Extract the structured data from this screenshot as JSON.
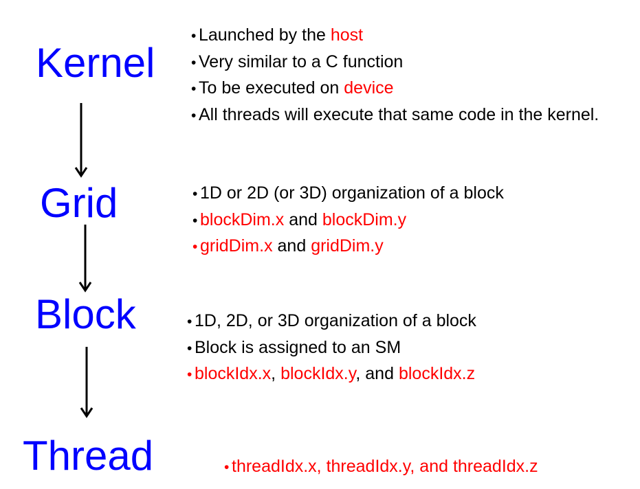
{
  "levels": {
    "kernel": {
      "title": "Kernel",
      "bullets": [
        [
          {
            "text": "Launched by the ",
            "color": "black"
          },
          {
            "text": "host",
            "color": "red"
          }
        ],
        [
          {
            "text": "Very similar to a C function",
            "color": "black"
          }
        ],
        [
          {
            "text": "To be executed on ",
            "color": "black"
          },
          {
            "text": "device",
            "color": "red"
          }
        ],
        [
          {
            "text": "All threads will execute that same code in the kernel.",
            "color": "black"
          }
        ]
      ]
    },
    "grid": {
      "title": "Grid",
      "bullets": [
        [
          {
            "text": "1D or 2D (or 3D) organization of a block",
            "color": "black"
          }
        ],
        [
          {
            "text": "blockDim.x",
            "color": "red"
          },
          {
            "text": " and ",
            "color": "black"
          },
          {
            "text": "blockDim.y",
            "color": "red"
          }
        ],
        [
          {
            "text": "gridDim.x",
            "color": "red"
          },
          {
            "text": " and ",
            "color": "black"
          },
          {
            "text": "gridDim.y",
            "color": "red"
          }
        ]
      ],
      "bullet_colors": [
        "black",
        "black",
        "red"
      ]
    },
    "block": {
      "title": "Block",
      "bullets": [
        [
          {
            "text": "1D, 2D, or 3D organization of a block",
            "color": "black"
          }
        ],
        [
          {
            "text": "Block is assigned to an SM",
            "color": "black"
          }
        ],
        [
          {
            "text": "blockIdx.x",
            "color": "red"
          },
          {
            "text": ", ",
            "color": "black"
          },
          {
            "text": "blockIdx.y",
            "color": "red"
          },
          {
            "text": ", and ",
            "color": "black"
          },
          {
            "text": "blockIdx.z",
            "color": "red"
          }
        ]
      ],
      "bullet_colors": [
        "black",
        "black",
        "red"
      ]
    },
    "thread": {
      "title": "Thread",
      "bullets": [
        [
          {
            "text": "threadIdx.x, threadIdx.y, and threadIdx.z",
            "color": "red"
          }
        ]
      ],
      "bullet_colors": [
        "red"
      ]
    }
  },
  "colors": {
    "title": "#0000ff",
    "highlight": "#ff0000",
    "text": "#000000"
  },
  "arrows": [
    "down-arrow",
    "down-arrow",
    "down-arrow"
  ]
}
